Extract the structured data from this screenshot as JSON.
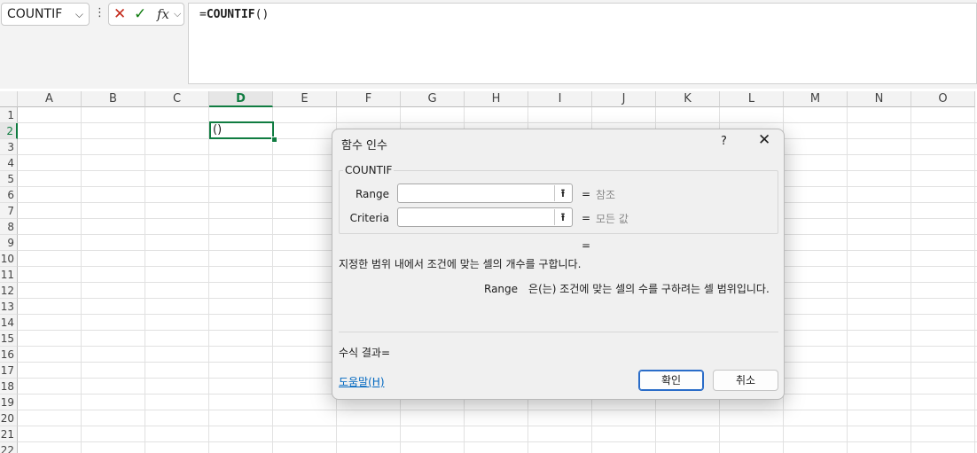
{
  "formula_bar": {
    "name_box": "COUNTIF",
    "name_box_chevron": "⌵",
    "more_icon": "⋮",
    "cancel_icon": "✕",
    "enter_icon": "✓",
    "fx_label": "fx",
    "fx_chevron": "⌵",
    "formula_prefix": "=",
    "formula_function": "COUNTIF",
    "formula_suffix": "()"
  },
  "sheet": {
    "columns": [
      "A",
      "B",
      "C",
      "D",
      "E",
      "F",
      "G",
      "H",
      "I",
      "J",
      "K",
      "L",
      "M",
      "N",
      "O"
    ],
    "active_column": "D",
    "rows": [
      "1",
      "2",
      "3",
      "4",
      "5",
      "6",
      "7",
      "8",
      "9",
      "10",
      "11",
      "12",
      "13",
      "14",
      "15",
      "16",
      "17",
      "18",
      "19",
      "20",
      "21",
      "22"
    ],
    "active_row": "2",
    "active_cell_value": "()"
  },
  "dialog": {
    "title": "함수 인수",
    "help_button": "?",
    "close_button": "✕",
    "function_name": "COUNTIF",
    "arguments": [
      {
        "label": "Range",
        "value": "",
        "equals": "=",
        "hint": "참조"
      },
      {
        "label": "Criteria",
        "value": "",
        "equals": "=",
        "hint": "모든 값"
      }
    ],
    "collapse_icon": "⭱",
    "result_equals": "=",
    "description": "지정한 범위 내에서 조건에 맞는 셀의 개수를 구합니다.",
    "arg_description_name": "Range",
    "arg_description_text": "은(는) 조건에 맞는 셀의 수를 구하려는 셀 범위입니다.",
    "formula_result": "수식 결과=",
    "help_link": "도움말(H)",
    "ok_button": "확인",
    "cancel_button": "취소"
  },
  "colors": {
    "excel_green": "#107c41",
    "cancel_red": "#c42b1c",
    "link_blue": "#0067c0",
    "ok_border": "#2a6cc8"
  }
}
